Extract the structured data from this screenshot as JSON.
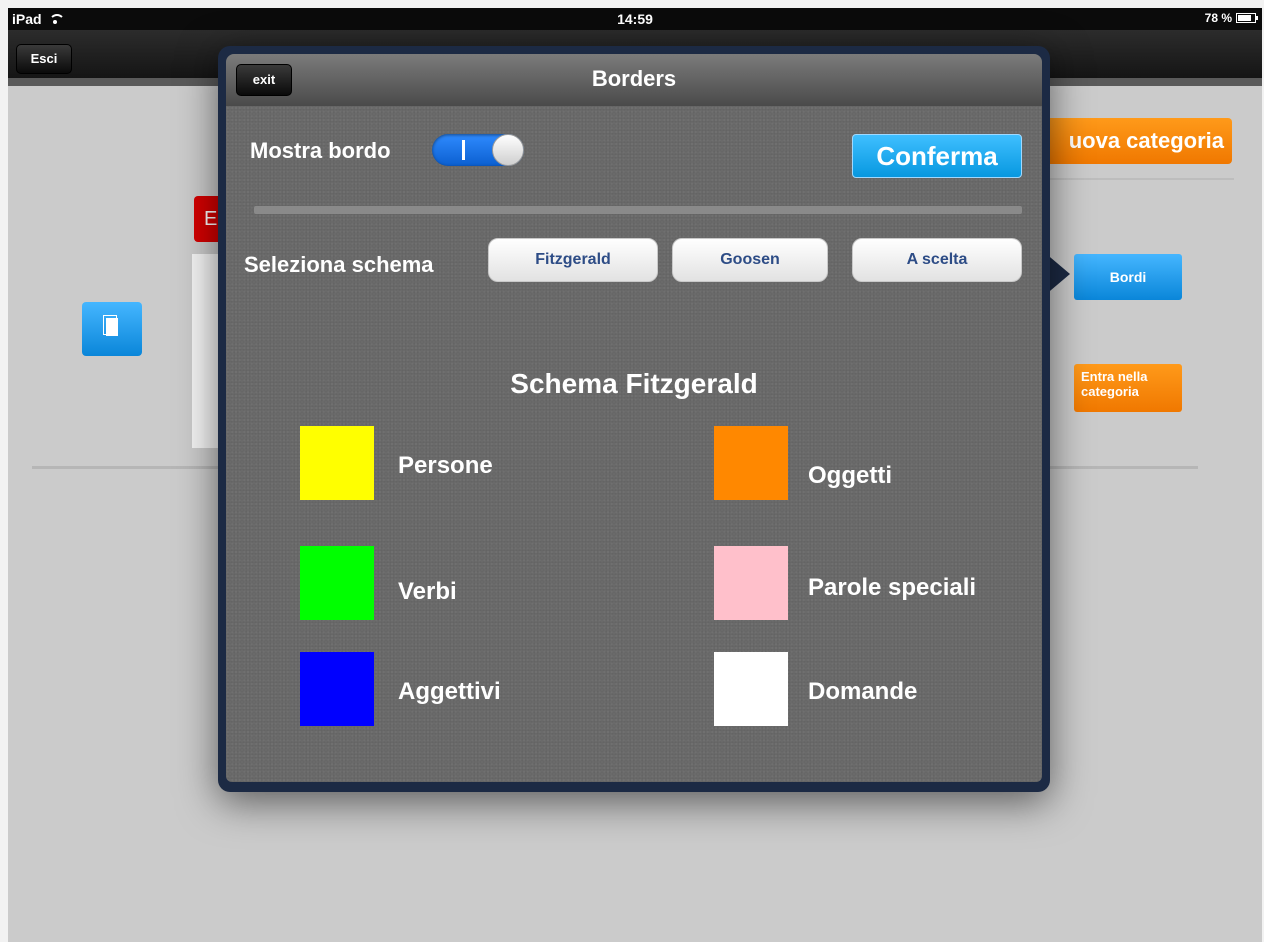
{
  "status_bar": {
    "device": "iPad",
    "time": "14:59",
    "battery": "78 %"
  },
  "nav": {
    "esci_label": "Esci"
  },
  "background": {
    "nuova_label": "uova categoria",
    "red_tag": "E",
    "bordi_label": "Bordi",
    "entra_label_line1": "Entra nella",
    "entra_label_line2": "categoria"
  },
  "popover": {
    "title": "Borders",
    "exit_label": "exit",
    "mostra_label": "Mostra bordo",
    "toggle_state": "on",
    "toggle_mark": "I",
    "conferma_label": "Conferma",
    "seleziona_label": "Seleziona schema",
    "schemes": [
      "Fitzgerald",
      "Goosen",
      "A scelta"
    ],
    "schema_title": "Schema Fitzgerald",
    "categories": [
      {
        "label": "Persone",
        "color": "#FFFF00"
      },
      {
        "label": "Oggetti",
        "color": "#FF8800"
      },
      {
        "label": "Verbi",
        "color": "#00FF00"
      },
      {
        "label": "Parole speciali",
        "color": "#FFC0CB"
      },
      {
        "label": "Aggettivi",
        "color": "#0000FF"
      },
      {
        "label": "Domande",
        "color": "#FFFFFF"
      }
    ]
  }
}
